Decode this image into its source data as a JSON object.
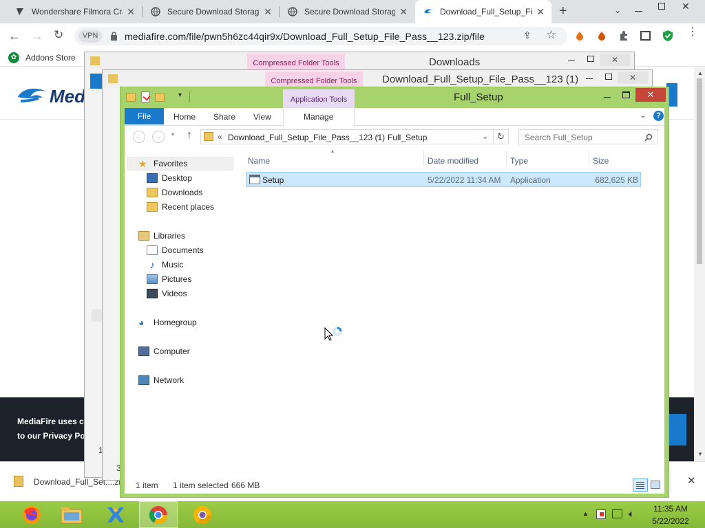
{
  "browser": {
    "tabs": [
      {
        "title": "Wondershare Filmora Cra"
      },
      {
        "title": "Secure Download Storag"
      },
      {
        "title": "Secure Download Storag"
      },
      {
        "title": "Download_Full_Setup_Fi"
      }
    ],
    "url": "mediafire.com/file/pwn5h6zc44qir9x/Download_Full_Setup_File_Pass__123.zip/file",
    "vpn_label": "VPN",
    "bookmark": "Addons Store"
  },
  "page": {
    "logo": "Med",
    "cookie_line1": "MediaFire uses c",
    "cookie_line2": "to our Privacy Po",
    "fragment1": "1",
    "fragment2": "3"
  },
  "download_bar": {
    "file": "Download_Full_Set....zip"
  },
  "back_windows": [
    {
      "ribbon_tab": "Compressed Folder Tools",
      "title": "Downloads"
    },
    {
      "ribbon_tab": "Compressed Folder Tools",
      "title": "Download_Full_Setup_File_Pass__123 (1)"
    }
  ],
  "explorer": {
    "title": "Full_Setup",
    "context_tab": "Application Tools",
    "ribbon": {
      "file": "File",
      "home": "Home",
      "share": "Share",
      "view": "View",
      "manage": "Manage"
    },
    "breadcrumb": {
      "overflow": "«",
      "parent": "Download_Full_Setup_File_Pass__123 (1)",
      "current": "Full_Setup"
    },
    "search_placeholder": "Search Full_Setup",
    "nav": {
      "favorites": "Favorites",
      "desktop": "Desktop",
      "downloads": "Downloads",
      "recent": "Recent places",
      "libraries": "Libraries",
      "documents": "Documents",
      "music": "Music",
      "pictures": "Pictures",
      "videos": "Videos",
      "homegroup": "Homegroup",
      "computer": "Computer",
      "network": "Network"
    },
    "columns": {
      "name": "Name",
      "date": "Date modified",
      "type": "Type",
      "size": "Size"
    },
    "files": [
      {
        "name": "Setup",
        "date": "5/22/2022 11:34 AM",
        "type": "Application",
        "size": "682,625 KB"
      }
    ],
    "status": {
      "items": "1 item",
      "selected": "1 item selected",
      "size": "666 MB"
    }
  },
  "taskbar": {
    "time": "11:35 AM",
    "date": "5/22/2022"
  },
  "colors": {
    "accent": "#1979ca",
    "window_frame": "#a6d36b",
    "taskbar": "#8fc13f",
    "selection": "#cce8ff"
  }
}
